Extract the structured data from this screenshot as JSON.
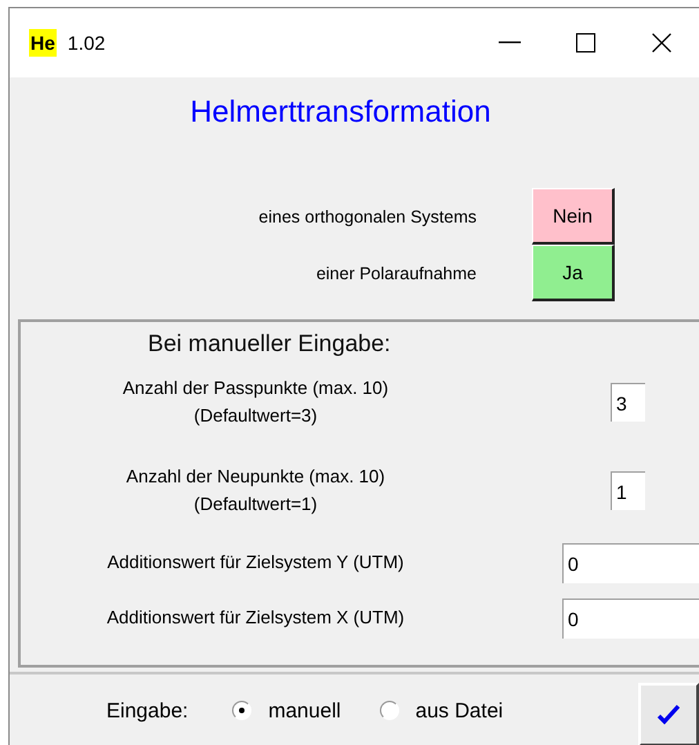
{
  "window": {
    "badge": "He",
    "title": "1.02"
  },
  "heading": "Helmerttransformation",
  "options": [
    {
      "label": "eines orthogonalen Systems",
      "button": "Nein",
      "kind": "no"
    },
    {
      "label": "einer Polaraufnahme",
      "button": "Ja",
      "kind": "yes"
    }
  ],
  "manual_panel": {
    "title": "Bei manueller Eingabe:",
    "fields": [
      {
        "label": "Anzahl der Passpunkte (max. 10)",
        "note": "(Defaultwert=3)",
        "value": "3",
        "kind": "short"
      },
      {
        "label": "Anzahl der Neupunkte (max. 10)",
        "note": "(Defaultwert=1)",
        "value": "1",
        "kind": "short"
      },
      {
        "label": "Additionswert für Zielsystem Y (UTM)",
        "value": "0",
        "kind": "wide"
      },
      {
        "label": "Additionswert für Zielsystem X (UTM)",
        "value": "0",
        "kind": "wide"
      }
    ]
  },
  "footer": {
    "label": "Eingabe:",
    "radios": [
      {
        "label": "manuell",
        "selected": true
      },
      {
        "label": "aus Datei",
        "selected": false
      }
    ]
  }
}
